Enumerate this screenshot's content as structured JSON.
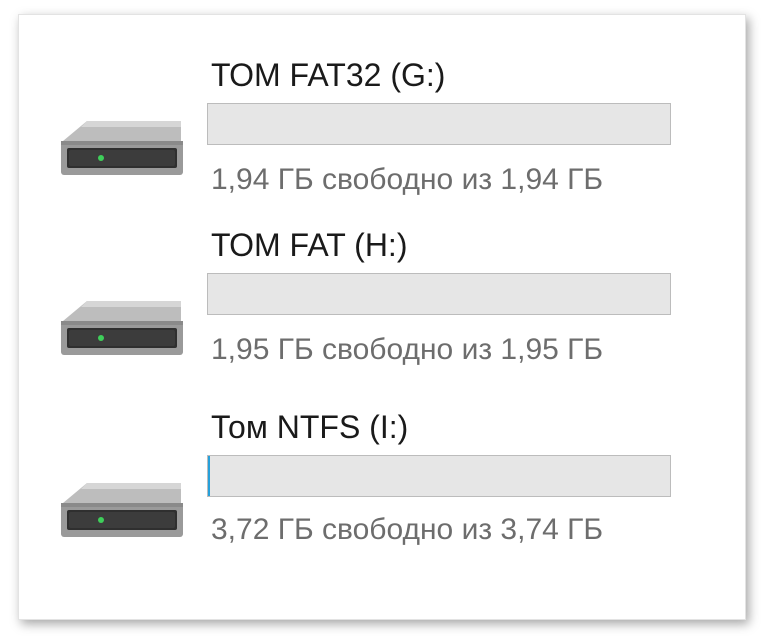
{
  "drives": [
    {
      "name": "ТОМ FAT32 (G:)",
      "free_text": "1,94 ГБ свободно из 1,94 ГБ",
      "used_fraction": 0.0,
      "icon": "hard-drive-icon"
    },
    {
      "name": "ТОМ FAT (H:)",
      "free_text": "1,95 ГБ свободно из 1,95 ГБ",
      "used_fraction": 0.0,
      "icon": "hard-drive-icon"
    },
    {
      "name": "Том NTFS (I:)",
      "free_text": "3,72 ГБ свободно из 3,74 ГБ",
      "used_fraction": 0.005,
      "icon": "hard-drive-icon"
    }
  ],
  "colors": {
    "bar_background": "#e6e6e6",
    "bar_border": "#bcbcbc",
    "bar_fill": "#26a0da",
    "led": "#3ecf5a"
  }
}
